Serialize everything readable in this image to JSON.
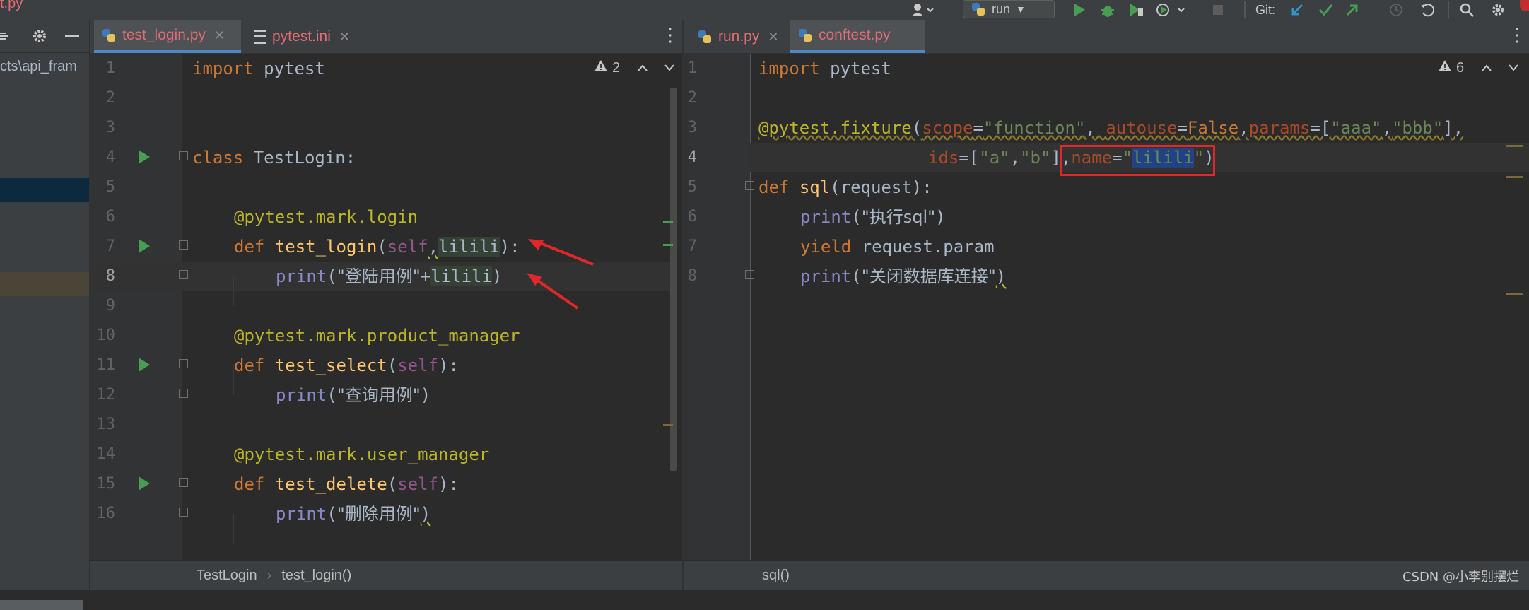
{
  "toolbar": {
    "file_title": "t.py",
    "run_config": "run",
    "git_label": "Git:"
  },
  "project_panel": {
    "path_fragment": "cts\\api_fram"
  },
  "left_editor": {
    "tabs": [
      {
        "label": "test_login.py",
        "active": true,
        "color": "#e06c75"
      },
      {
        "label": "pytest.ini",
        "active": false,
        "color": "#e06c75"
      }
    ],
    "inspection_count": "2",
    "line_numbers": [
      "1",
      "2",
      "3",
      "4",
      "5",
      "6",
      "7",
      "8",
      "9",
      "10",
      "11",
      "12",
      "13",
      "14",
      "15",
      "16"
    ],
    "code": {
      "l1": {
        "kw": "import",
        "rest": " pytest"
      },
      "l4": {
        "kw": "class",
        "rest": " TestLogin:"
      },
      "l6": "@pytest.mark.login",
      "l7": {
        "kw": "def",
        "fn": "test_login",
        "open": "(",
        "self": "self",
        "comma": ",",
        "param": "lilili",
        "close": "):"
      },
      "l8": {
        "call": "print",
        "open": "(",
        "str": "\"登陆用例\"",
        "plus": "+",
        "var": "lilili",
        "close": ")"
      },
      "l10": "@pytest.mark.product_manager",
      "l11": {
        "kw": "def",
        "fn": "test_select",
        "open": "(",
        "self": "self",
        "close": "):"
      },
      "l12": {
        "call": "print",
        "open": "(",
        "str": "\"查询用例\"",
        "close": ")"
      },
      "l14": "@pytest.mark.user_manager",
      "l15": {
        "kw": "def",
        "fn": "test_delete",
        "open": "(",
        "self": "self",
        "close": "):"
      },
      "l16": {
        "call": "print",
        "open": "(",
        "str": "\"删除用例\"",
        "close": ")"
      }
    },
    "breadcrumbs": [
      "TestLogin",
      "test_login()"
    ]
  },
  "right_editor": {
    "tabs": [
      {
        "label": "run.py",
        "active": false,
        "color": "#e06c75"
      },
      {
        "label": "conftest.py",
        "active": true,
        "color": "#e06c75"
      }
    ],
    "inspection_count": "6",
    "line_numbers": [
      "1",
      "2",
      "3",
      "4",
      "5",
      "6",
      "7",
      "8"
    ],
    "code": {
      "l1": {
        "kw": "import",
        "rest": " pytest"
      },
      "l3": {
        "dec": "@pytest.fixture",
        "open": "(",
        "k1": "scope",
        "eq1": "=",
        "v1": "\"function\"",
        "c1": ", ",
        "k2": "autouse",
        "eq2": "=",
        "v2": "False",
        "c2": ",",
        "k3": "params",
        "eq3": "=[",
        "v3a": "\"aaa\"",
        "c3": ",",
        "v3b": "\"bbb\"",
        "end": "],"
      },
      "l4": {
        "k4": "ids",
        "eq4": "=[",
        "v4a": "\"a\"",
        "c4": ",",
        "v4b": "\"b\"",
        "end4": "]",
        "c5": ",",
        "k5": "name",
        "eq5": "=",
        "q1": "\"",
        "v5": "lilili",
        "q2": "\"",
        "close": ")"
      },
      "l5": {
        "kw": "def",
        "fn": "sql",
        "rest": "(request):"
      },
      "l6": {
        "call": "print",
        "open": "(",
        "str": "\"执行sql\"",
        "close": ")"
      },
      "l7": {
        "kw": "yield",
        "rest": " request.param"
      },
      "l8": {
        "call": "print",
        "open": "(",
        "str": "\"关闭数据库连接\"",
        "close": ")"
      }
    },
    "breadcrumbs": [
      "sql()"
    ]
  },
  "watermark": "CSDN @小李别摆烂",
  "colors": {
    "annotation_red": "#e0282b",
    "selection_blue": "#214283",
    "run_green": "#499c54"
  }
}
